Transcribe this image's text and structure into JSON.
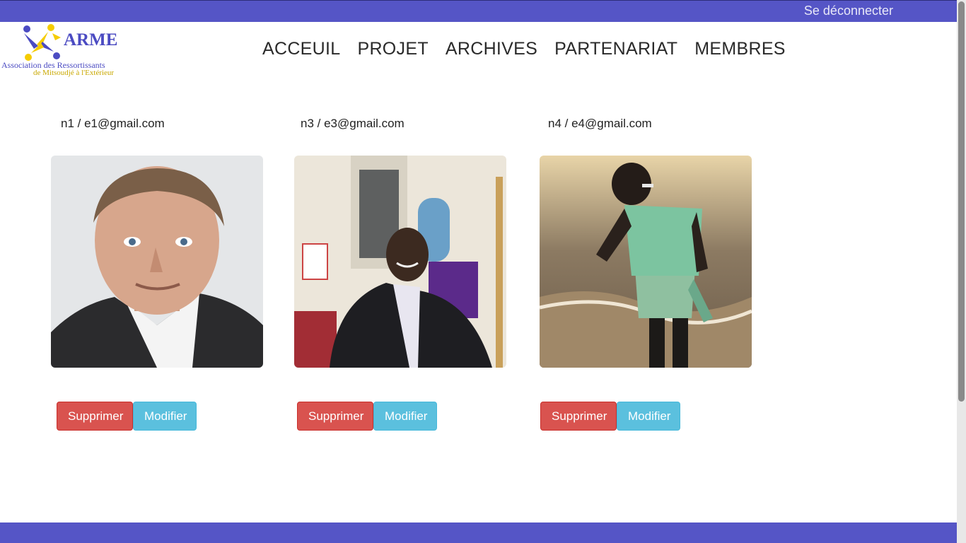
{
  "header": {
    "logout_label": "Se déconnecter"
  },
  "logo": {
    "word": "ARME",
    "line1": "Association des Ressortissants",
    "line2": "de Mitsoudjé à l'Extérieur",
    "colors": {
      "blue": "#4b4bc2",
      "yellow": "#f5cc00"
    }
  },
  "nav": {
    "items": [
      {
        "label": "ACCEUIL"
      },
      {
        "label": "PROJET"
      },
      {
        "label": "ARCHIVES"
      },
      {
        "label": "PARTENARIAT"
      },
      {
        "label": "MEMBRES"
      }
    ]
  },
  "members": [
    {
      "name": "n1",
      "separator": " / ",
      "email": "e1@gmail.com",
      "photo_icon": "portrait-man-photo"
    },
    {
      "name": "n3",
      "separator": " / ",
      "email": "e3@gmail.com",
      "photo_icon": "portrait-church-photo"
    },
    {
      "name": "n4",
      "separator": " / ",
      "email": "e4@gmail.com",
      "photo_icon": "beach-photo"
    }
  ],
  "actions": {
    "delete_label": "Supprimer",
    "edit_label": "Modifier"
  },
  "colors": {
    "bar": "#5555c6",
    "delete": "#d9534f",
    "edit": "#5bc0de"
  }
}
